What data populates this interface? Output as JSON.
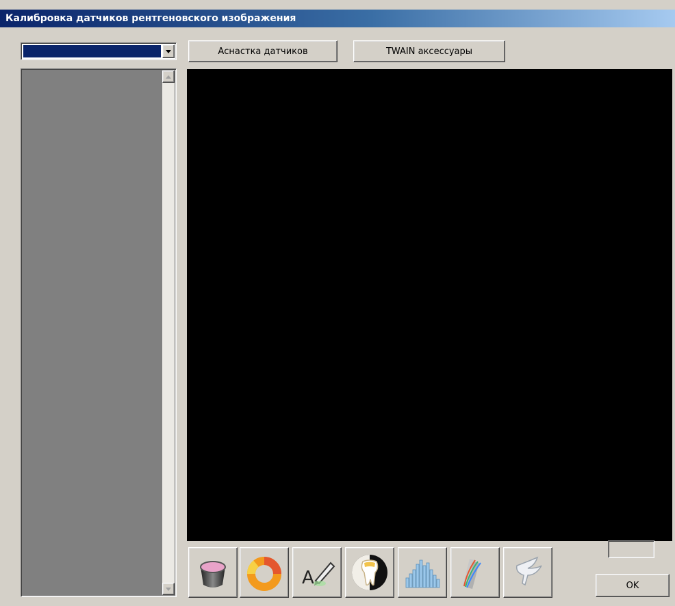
{
  "window": {
    "title": "Калибровка датчиков рентгеновского изображения"
  },
  "sensor_select": {
    "selected": ""
  },
  "buttons": {
    "sensor_equipment": "Аснастка датчиков",
    "twain_accessories": "TWAIN аксессуары",
    "ok": "OK"
  },
  "tools": [
    {
      "icon": "sensor-cup-icon"
    },
    {
      "icon": "color-ring-icon"
    },
    {
      "icon": "text-annotate-icon"
    },
    {
      "icon": "tooth-icon"
    },
    {
      "icon": "histogram-icon"
    },
    {
      "icon": "gradient-curves-icon"
    },
    {
      "icon": "bird-icon"
    }
  ],
  "colors": {
    "window_bg": "#d4d0c8",
    "title_start": "#0a246a",
    "viewer_bg": "#000000",
    "list_bg": "#808080"
  }
}
